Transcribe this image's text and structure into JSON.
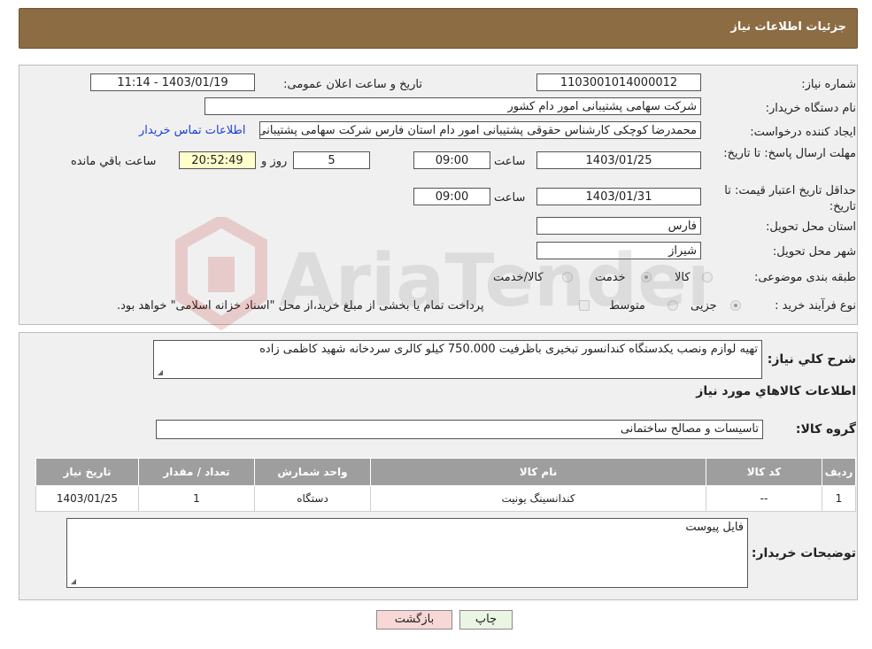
{
  "header": {
    "title": "جزئیات اطلاعات نیاز"
  },
  "form": {
    "need_number_label": "شماره نیاز:",
    "need_number": "1103001014000012",
    "announce_label": "تاریخ و ساعت اعلان عمومی:",
    "announce_value": "1403/01/19 - 11:14",
    "buyer_org_label": "نام دستگاه خریدار:",
    "buyer_org": "شرکت سهامی پشتیبانی امور دام کشور",
    "creator_label": "ایجاد کننده درخواست:",
    "creator": "محمدرضا کوچکی کارشناس حقوقی پشتیبانی امور دام استان فارس شرکت سهامی پشتیبانی امور دام کشور",
    "contact_link": "اطلاعات تماس خریدار",
    "deadline_label": "مهلت ارسال پاسخ: تا تاریخ:",
    "deadline_date": "1403/01/25",
    "time_label": "ساعت",
    "deadline_time": "09:00",
    "days_value": "5",
    "days_label": "روز و",
    "remaining_time": "20:52:49",
    "remaining_label": "ساعت باقي مانده",
    "validity_label": "حداقل تاریخ اعتبار قیمت: تا تاریخ:",
    "validity_date": "1403/01/31",
    "validity_time": "09:00",
    "province_label": "استان محل تحویل:",
    "province": "فارس",
    "city_label": "شهر محل تحویل:",
    "city": "شیراز",
    "category_label": "طبقه بندی موضوعی:",
    "category_options": [
      "کالا",
      "خدمت",
      "کالا/خدمت"
    ],
    "purchase_type_label": "نوع فرآیند خرید :",
    "purchase_options": [
      "جزیی",
      "متوسط"
    ],
    "purchase_note": "پرداخت تمام یا بخشی از مبلغ خرید،از محل \"اسناد خزانه اسلامی\" خواهد بود."
  },
  "details": {
    "summary_label": "شرح کلي نياز:",
    "summary": "تهیه لوازم ونصب  یکدستگاه  کندانسور تبخیری باظرفیت 750.000 کیلو کالری سردخانه شهید کاظمی زاده",
    "goods_info_title": "اطلاعات کالاهاي مورد نياز",
    "goods_group_label": "گروه کالا:",
    "goods_group": "تاسیسات و مصالح ساختمانی",
    "table": {
      "headers": [
        "رديف",
        "کد کالا",
        "نام کالا",
        "واحد شمارش",
        "تعداد / مقدار",
        "تاریخ نیاز"
      ],
      "rows": [
        [
          "1",
          "--",
          "کندانسینگ یونیت",
          "دستگاه",
          "1",
          "1403/01/25"
        ]
      ]
    },
    "buyer_notes_label": "توضیحات خریدار:",
    "buyer_notes": "فایل پیوست"
  },
  "buttons": {
    "print": "چاپ",
    "back": "بازگشت"
  },
  "watermark": {
    "text": "AriaTender.neT"
  },
  "colors": {
    "header": "#8b6c43",
    "link": "#1a3fd6",
    "table_header": "#9e9e9e",
    "back_button": "#f8d7d7"
  }
}
